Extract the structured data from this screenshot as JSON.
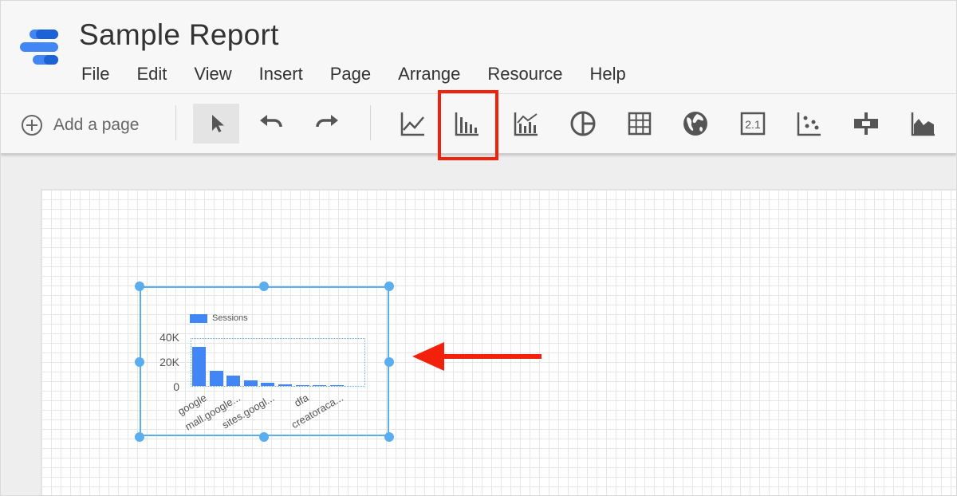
{
  "app": {
    "title": "Sample Report"
  },
  "menu": [
    "File",
    "Edit",
    "View",
    "Insert",
    "Page",
    "Arrange",
    "Resource",
    "Help"
  ],
  "toolbar": {
    "add_page_label": "Add a page",
    "tools": [
      {
        "name": "select-tool",
        "icon": "cursor-icon",
        "selected": true
      },
      {
        "name": "undo-button",
        "icon": "undo-icon"
      },
      {
        "name": "redo-button",
        "icon": "redo-icon"
      },
      {
        "name": "time-series-tool",
        "icon": "time-series-icon"
      },
      {
        "name": "bar-chart-tool",
        "icon": "bar-chart-icon",
        "highlighted": true
      },
      {
        "name": "combo-chart-tool",
        "icon": "combo-chart-icon"
      },
      {
        "name": "pie-chart-tool",
        "icon": "pie-chart-icon"
      },
      {
        "name": "table-tool",
        "icon": "table-icon"
      },
      {
        "name": "geo-map-tool",
        "icon": "globe-icon"
      },
      {
        "name": "scorecard-tool",
        "icon": "scorecard-icon",
        "label": "2.1"
      },
      {
        "name": "scatter-chart-tool",
        "icon": "scatter-icon"
      },
      {
        "name": "bullet-chart-tool",
        "icon": "bullet-icon"
      },
      {
        "name": "area-chart-tool",
        "icon": "area-chart-icon"
      }
    ]
  },
  "colors": {
    "accent": "#4285f4",
    "selection": "#5aaef0",
    "annotation": "#f2210b"
  },
  "chart_data": {
    "type": "bar",
    "legend": [
      "Sessions"
    ],
    "legend_position": "top-left",
    "yticks": [
      "40K",
      "20K",
      "0"
    ],
    "ylim": [
      0,
      40000
    ],
    "x_labels_visible": [
      "google",
      "mall.google...",
      "sites.googl...",
      "dfa",
      "creatoraca..."
    ],
    "series": [
      {
        "name": "Sessions",
        "values": [
          33000,
          13000,
          8500,
          5000,
          3000,
          1500,
          1000,
          700,
          500
        ]
      }
    ]
  }
}
